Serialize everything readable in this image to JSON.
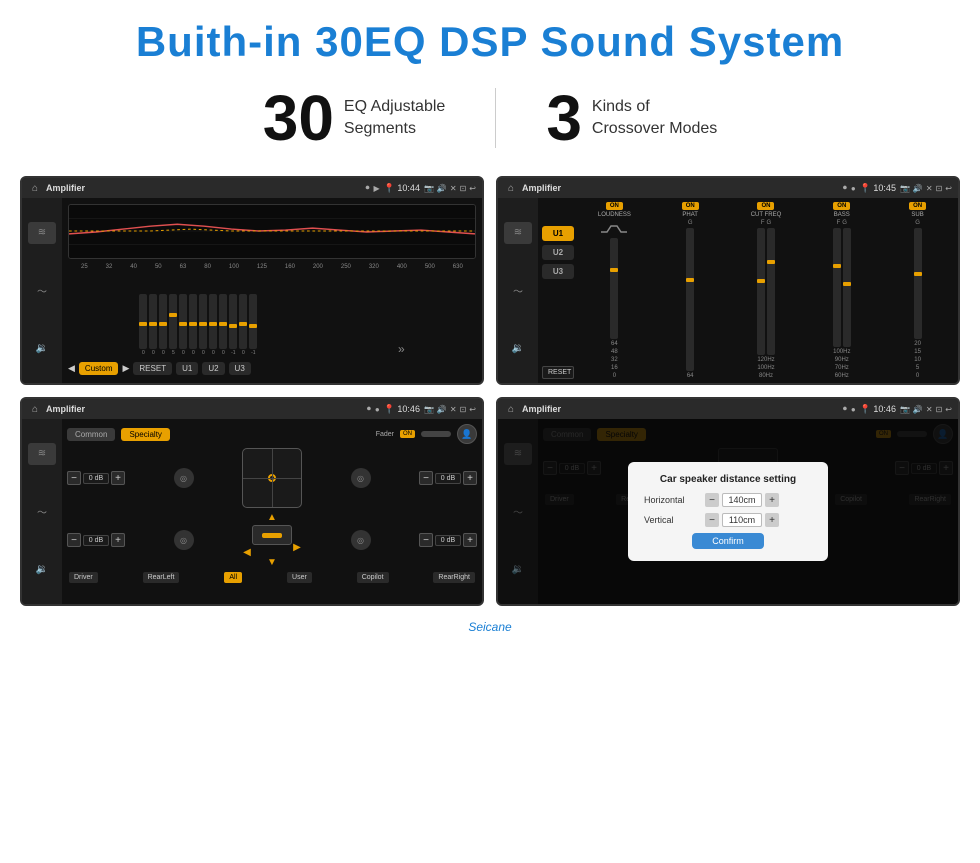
{
  "page": {
    "title": "Buith-in 30EQ DSP Sound System",
    "stat1": {
      "number": "30",
      "label": "EQ Adjustable\nSegments"
    },
    "stat2": {
      "number": "3",
      "label": "Kinds of\nCrossover Modes"
    }
  },
  "screen1": {
    "title": "Amplifier",
    "time": "10:44",
    "freqs": [
      "25",
      "32",
      "40",
      "50",
      "63",
      "80",
      "100",
      "125",
      "160",
      "200",
      "250",
      "320",
      "400",
      "500",
      "630"
    ],
    "sliderVals": [
      "0",
      "0",
      "0",
      "5",
      "0",
      "0",
      "0",
      "0",
      "0",
      "-1",
      "0",
      "-1"
    ],
    "presetLabel": "Custom",
    "btnReset": "RESET",
    "btnU1": "U1",
    "btnU2": "U2",
    "btnU3": "U3"
  },
  "screen2": {
    "title": "Amplifier",
    "time": "10:45",
    "uBtns": [
      "U1",
      "U2",
      "U3"
    ],
    "cols": [
      {
        "toggle": "ON",
        "label": "LOUDNESS"
      },
      {
        "toggle": "ON",
        "label": "PHAT"
      },
      {
        "toggle": "ON",
        "label": "CUT FREQ"
      },
      {
        "toggle": "ON",
        "label": "BASS"
      },
      {
        "toggle": "ON",
        "label": "SUB"
      }
    ],
    "btnReset": "RESET"
  },
  "screen3": {
    "title": "Amplifier",
    "time": "10:46",
    "tabCommon": "Common",
    "tabSpecialty": "Specialty",
    "faderLabel": "Fader",
    "faderOn": "ON",
    "dbValues": [
      "0 dB",
      "0 dB",
      "0 dB",
      "0 dB"
    ],
    "buttons": [
      "Driver",
      "RearLeft",
      "All",
      "Copilot",
      "RearRight",
      "User"
    ]
  },
  "screen4": {
    "title": "Amplifier",
    "time": "10:46",
    "tabCommon": "Common",
    "tabSpecialty": "Specialty",
    "dialog": {
      "title": "Car speaker distance setting",
      "horizontal": {
        "label": "Horizontal",
        "value": "140cm"
      },
      "vertical": {
        "label": "Vertical",
        "value": "110cm"
      },
      "confirmBtn": "Confirm"
    },
    "dbValues": [
      "0 dB",
      "0 dB"
    ],
    "buttons": [
      "Driver",
      "RearLeft",
      "Copilot",
      "RearRight",
      "User"
    ]
  },
  "watermark": "Seicane"
}
